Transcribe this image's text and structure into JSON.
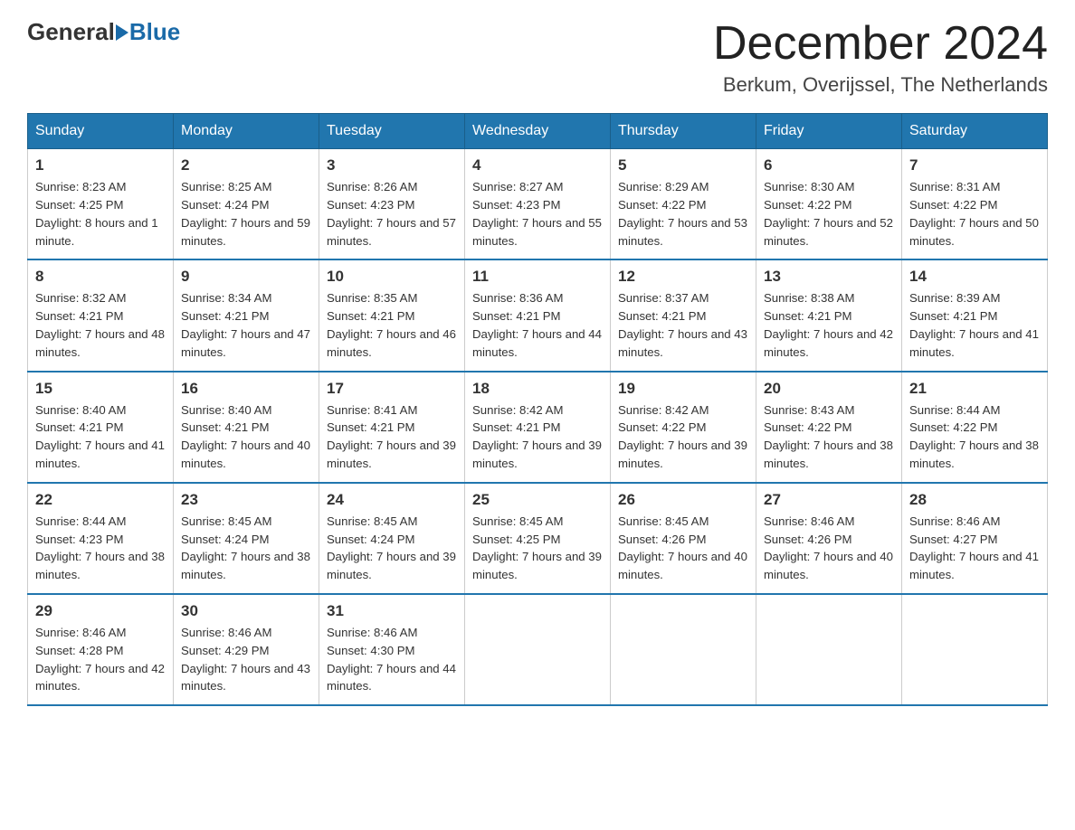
{
  "header": {
    "logo_general": "General",
    "logo_blue": "Blue",
    "month_title": "December 2024",
    "location": "Berkum, Overijssel, The Netherlands"
  },
  "days_of_week": [
    "Sunday",
    "Monday",
    "Tuesday",
    "Wednesday",
    "Thursday",
    "Friday",
    "Saturday"
  ],
  "weeks": [
    [
      {
        "day": "1",
        "sunrise": "8:23 AM",
        "sunset": "4:25 PM",
        "daylight": "8 hours and 1 minute."
      },
      {
        "day": "2",
        "sunrise": "8:25 AM",
        "sunset": "4:24 PM",
        "daylight": "7 hours and 59 minutes."
      },
      {
        "day": "3",
        "sunrise": "8:26 AM",
        "sunset": "4:23 PM",
        "daylight": "7 hours and 57 minutes."
      },
      {
        "day": "4",
        "sunrise": "8:27 AM",
        "sunset": "4:23 PM",
        "daylight": "7 hours and 55 minutes."
      },
      {
        "day": "5",
        "sunrise": "8:29 AM",
        "sunset": "4:22 PM",
        "daylight": "7 hours and 53 minutes."
      },
      {
        "day": "6",
        "sunrise": "8:30 AM",
        "sunset": "4:22 PM",
        "daylight": "7 hours and 52 minutes."
      },
      {
        "day": "7",
        "sunrise": "8:31 AM",
        "sunset": "4:22 PM",
        "daylight": "7 hours and 50 minutes."
      }
    ],
    [
      {
        "day": "8",
        "sunrise": "8:32 AM",
        "sunset": "4:21 PM",
        "daylight": "7 hours and 48 minutes."
      },
      {
        "day": "9",
        "sunrise": "8:34 AM",
        "sunset": "4:21 PM",
        "daylight": "7 hours and 47 minutes."
      },
      {
        "day": "10",
        "sunrise": "8:35 AM",
        "sunset": "4:21 PM",
        "daylight": "7 hours and 46 minutes."
      },
      {
        "day": "11",
        "sunrise": "8:36 AM",
        "sunset": "4:21 PM",
        "daylight": "7 hours and 44 minutes."
      },
      {
        "day": "12",
        "sunrise": "8:37 AM",
        "sunset": "4:21 PM",
        "daylight": "7 hours and 43 minutes."
      },
      {
        "day": "13",
        "sunrise": "8:38 AM",
        "sunset": "4:21 PM",
        "daylight": "7 hours and 42 minutes."
      },
      {
        "day": "14",
        "sunrise": "8:39 AM",
        "sunset": "4:21 PM",
        "daylight": "7 hours and 41 minutes."
      }
    ],
    [
      {
        "day": "15",
        "sunrise": "8:40 AM",
        "sunset": "4:21 PM",
        "daylight": "7 hours and 41 minutes."
      },
      {
        "day": "16",
        "sunrise": "8:40 AM",
        "sunset": "4:21 PM",
        "daylight": "7 hours and 40 minutes."
      },
      {
        "day": "17",
        "sunrise": "8:41 AM",
        "sunset": "4:21 PM",
        "daylight": "7 hours and 39 minutes."
      },
      {
        "day": "18",
        "sunrise": "8:42 AM",
        "sunset": "4:21 PM",
        "daylight": "7 hours and 39 minutes."
      },
      {
        "day": "19",
        "sunrise": "8:42 AM",
        "sunset": "4:22 PM",
        "daylight": "7 hours and 39 minutes."
      },
      {
        "day": "20",
        "sunrise": "8:43 AM",
        "sunset": "4:22 PM",
        "daylight": "7 hours and 38 minutes."
      },
      {
        "day": "21",
        "sunrise": "8:44 AM",
        "sunset": "4:22 PM",
        "daylight": "7 hours and 38 minutes."
      }
    ],
    [
      {
        "day": "22",
        "sunrise": "8:44 AM",
        "sunset": "4:23 PM",
        "daylight": "7 hours and 38 minutes."
      },
      {
        "day": "23",
        "sunrise": "8:45 AM",
        "sunset": "4:24 PM",
        "daylight": "7 hours and 38 minutes."
      },
      {
        "day": "24",
        "sunrise": "8:45 AM",
        "sunset": "4:24 PM",
        "daylight": "7 hours and 39 minutes."
      },
      {
        "day": "25",
        "sunrise": "8:45 AM",
        "sunset": "4:25 PM",
        "daylight": "7 hours and 39 minutes."
      },
      {
        "day": "26",
        "sunrise": "8:45 AM",
        "sunset": "4:26 PM",
        "daylight": "7 hours and 40 minutes."
      },
      {
        "day": "27",
        "sunrise": "8:46 AM",
        "sunset": "4:26 PM",
        "daylight": "7 hours and 40 minutes."
      },
      {
        "day": "28",
        "sunrise": "8:46 AM",
        "sunset": "4:27 PM",
        "daylight": "7 hours and 41 minutes."
      }
    ],
    [
      {
        "day": "29",
        "sunrise": "8:46 AM",
        "sunset": "4:28 PM",
        "daylight": "7 hours and 42 minutes."
      },
      {
        "day": "30",
        "sunrise": "8:46 AM",
        "sunset": "4:29 PM",
        "daylight": "7 hours and 43 minutes."
      },
      {
        "day": "31",
        "sunrise": "8:46 AM",
        "sunset": "4:30 PM",
        "daylight": "7 hours and 44 minutes."
      },
      null,
      null,
      null,
      null
    ]
  ]
}
